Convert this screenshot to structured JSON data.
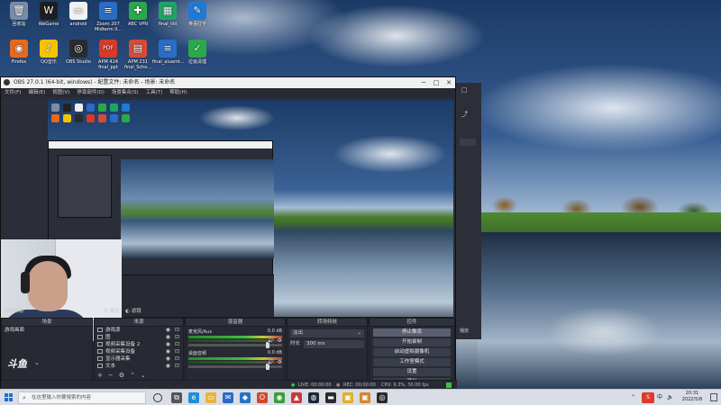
{
  "desktop": {
    "icons": [
      {
        "label": "回收站",
        "color": "#7a8ca8",
        "glyph": "🗑"
      },
      {
        "label": "WeGame",
        "color": "#1e1e1e",
        "glyph": "W"
      },
      {
        "label": "android",
        "color": "#f2f2f2",
        "glyph": "▭"
      },
      {
        "label": "Zoom 207 Midterm II...",
        "color": "#2b6cc4",
        "glyph": "≡"
      },
      {
        "label": "ABC VPN",
        "color": "#2aa84a",
        "glyph": "✚"
      },
      {
        "label": "final_iiiii",
        "color": "#21a366",
        "glyph": "▦"
      },
      {
        "label": "英语打字",
        "color": "#1e7ad6",
        "glyph": "✎"
      },
      {
        "label": "Firefox",
        "color": "#e66a1c",
        "glyph": "◉"
      },
      {
        "label": "QQ音乐",
        "color": "#f5c400",
        "glyph": "♪"
      },
      {
        "label": "OBS Studio",
        "color": "#2b2b2b",
        "glyph": "◎"
      },
      {
        "label": "APM 424 final_ppt",
        "color": "#d63a2a",
        "glyph": "PDF"
      },
      {
        "label": "APM 231 final_Scho...",
        "color": "#d64a3a",
        "glyph": "▤"
      },
      {
        "label": "final_aluamt...",
        "color": "#2b6cc4",
        "glyph": "≡"
      },
      {
        "label": "垃圾清理",
        "color": "#2aa84a",
        "glyph": "✓"
      }
    ]
  },
  "obs": {
    "title": "OBS 27.0.1 (64-bit, windows) - 配置文件: 未命名 - 场景: 未命名",
    "menu": [
      "文件(F)",
      "编辑(E)",
      "视图(V)",
      "停靠部件(D)",
      "场景集合(S)",
      "工具(T)",
      "帮助(H)"
    ],
    "window_buttons": [
      "─",
      "□",
      "✕"
    ],
    "source_toolbar": {
      "label": "未选择源",
      "properties": "属性",
      "filters": "滤镜"
    },
    "docks": {
      "scenes": {
        "title": "场景",
        "items": [
          "游戏画面"
        ]
      },
      "sources": {
        "title": "来源",
        "items": [
          "游戏源",
          "图",
          "视频采集设备 2",
          "视频采集设备",
          "显示器采集",
          "文本"
        ]
      },
      "mixer": {
        "title": "混音器",
        "channels": [
          {
            "name": "麦克风/Aux",
            "db": "0.0 dB"
          },
          {
            "name": "桌面音频",
            "db": "0.0 dB"
          }
        ]
      },
      "transitions": {
        "title": "转场特效",
        "type": "淡出",
        "duration_label": "时长",
        "duration": "300 ms"
      },
      "controls": {
        "title": "控件",
        "buttons": [
          "停止推流",
          "开始录制",
          "启动虚拟摄像机",
          "工作室模式",
          "设置",
          "退出"
        ]
      }
    },
    "status": {
      "live": "LIVE: 00:00:00",
      "rec": "REC: 00:00:00",
      "cpu": "CPU: 6.3%, 30.00 fps"
    }
  },
  "behind_window": {
    "text": "播放"
  },
  "taskbar": {
    "search_placeholder": "在这里输入你要搜索的内容",
    "apps": [
      {
        "name": "task-view",
        "color": "#555",
        "glyph": "⧉"
      },
      {
        "name": "edge",
        "color": "#1c8fd8",
        "glyph": "e"
      },
      {
        "name": "file-explorer",
        "color": "#e8b53a",
        "glyph": "▭"
      },
      {
        "name": "mail",
        "color": "#2b6cc4",
        "glyph": "✉"
      },
      {
        "name": "vscode",
        "color": "#2276c8",
        "glyph": "◆"
      },
      {
        "name": "office",
        "color": "#d04a2a",
        "glyph": "O"
      },
      {
        "name": "chrome",
        "color": "#3a9c3a",
        "glyph": "◉"
      },
      {
        "name": "app-red",
        "color": "#c83a3a",
        "glyph": "▲"
      },
      {
        "name": "steam",
        "color": "#1b2838",
        "glyph": "◍"
      },
      {
        "name": "app-dark",
        "color": "#2a2a2a",
        "glyph": "▬"
      },
      {
        "name": "app-yellow",
        "color": "#e0b020",
        "glyph": "▣"
      },
      {
        "name": "app-orange",
        "color": "#d6842a",
        "glyph": "▣"
      },
      {
        "name": "obs",
        "color": "#2b2b2b",
        "glyph": "◎"
      }
    ],
    "tray": {
      "ime": "中",
      "ime_badge": "S"
    },
    "clock": {
      "time": "20:31",
      "date": "2022/5/8"
    }
  },
  "colors": {
    "obs_bg": "#2b2e38",
    "obs_dock": "#272a33",
    "accent": "#1d6fd6"
  }
}
